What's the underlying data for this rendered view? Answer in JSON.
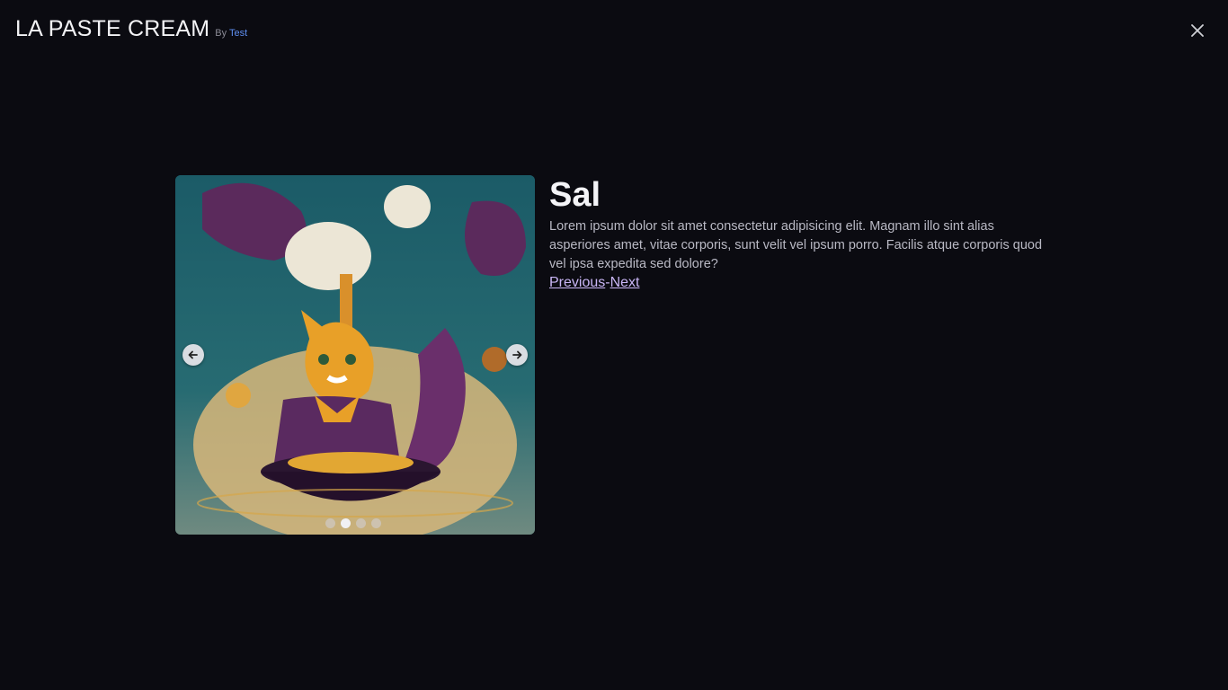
{
  "header": {
    "brand": "LA PASTE CREAM",
    "by_label": "By",
    "author": "Test"
  },
  "icons": {
    "close": "close-icon",
    "prev": "arrow-left-icon",
    "next": "arrow-right-icon"
  },
  "carousel": {
    "slide_count": 4,
    "active_index": 1,
    "image_description": "cat-chef-illustration"
  },
  "detail": {
    "title": "Sal",
    "description": "Lorem ipsum dolor sit amet consectetur adipisicing elit. Magnam illo sint alias asperiores amet, vitae corporis, sunt velit vel ipsum porro. Facilis atque corporis quod vel ipsa expedita sed dolore?",
    "previous_label": "Previous",
    "separator": "-",
    "next_label": "Next"
  },
  "colors": {
    "background": "#0b0b11",
    "link": "#c9b6f5",
    "author_link": "#5e8ef0"
  }
}
